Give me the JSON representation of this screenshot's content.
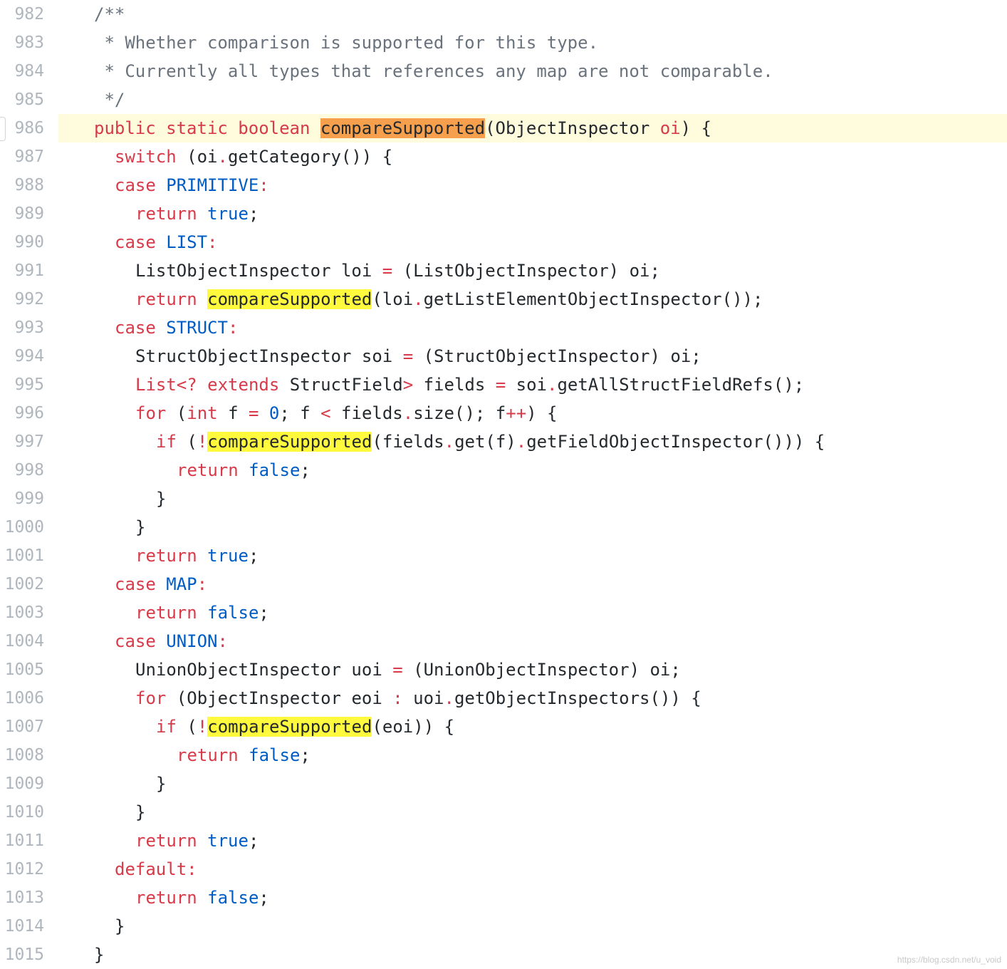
{
  "current_line": 986,
  "search_term": "compareSupported",
  "colors": {
    "keyword": "#d73a49",
    "literal": "#005cc5",
    "comment": "#6a737d",
    "plain": "#24292e",
    "line_number": "#b0b6bd",
    "current_line_bg": "#fffbdd",
    "current_match_bg": "#f6a04d",
    "match_bg": "#fffa3d"
  },
  "lines": [
    {
      "n": "982",
      "indent": 0,
      "tokens": [
        {
          "t": "/**",
          "c": "cm"
        }
      ]
    },
    {
      "n": "983",
      "indent": 0,
      "tokens": [
        {
          "t": " * Whether comparison is supported for this type.",
          "c": "cm"
        }
      ]
    },
    {
      "n": "984",
      "indent": 0,
      "tokens": [
        {
          "t": " * Currently all types that references any map are not comparable.",
          "c": "cm"
        }
      ]
    },
    {
      "n": "985",
      "indent": 0,
      "tokens": [
        {
          "t": " */",
          "c": "cm"
        }
      ]
    },
    {
      "n": "986",
      "indent": 0,
      "tokens": [
        {
          "t": "public static boolean",
          "c": "kw"
        },
        {
          "t": " "
        },
        {
          "t": "compareSupported",
          "hl": "current"
        },
        {
          "t": "(ObjectInspector "
        },
        {
          "t": "oi",
          "c": "kw"
        },
        {
          "t": ") {"
        }
      ]
    },
    {
      "n": "987",
      "indent": 1,
      "tokens": [
        {
          "t": "switch",
          "c": "kw"
        },
        {
          "t": " (oi"
        },
        {
          "t": ".",
          "c": "op"
        },
        {
          "t": "getCategory()) {"
        }
      ]
    },
    {
      "n": "988",
      "indent": 1,
      "tokens": [
        {
          "t": "case",
          "c": "kw"
        },
        {
          "t": " "
        },
        {
          "t": "PRIMITIVE",
          "c": "lit"
        },
        {
          "t": ":",
          "c": "op"
        }
      ]
    },
    {
      "n": "989",
      "indent": 2,
      "tokens": [
        {
          "t": "return",
          "c": "kw"
        },
        {
          "t": " "
        },
        {
          "t": "true",
          "c": "lit"
        },
        {
          "t": ";"
        }
      ]
    },
    {
      "n": "990",
      "indent": 1,
      "tokens": [
        {
          "t": "case",
          "c": "kw"
        },
        {
          "t": " "
        },
        {
          "t": "LIST",
          "c": "lit"
        },
        {
          "t": ":",
          "c": "op"
        }
      ]
    },
    {
      "n": "991",
      "indent": 2,
      "tokens": [
        {
          "t": "ListObjectInspector loi "
        },
        {
          "t": "=",
          "c": "op"
        },
        {
          "t": " (ListObjectInspector) oi;"
        }
      ]
    },
    {
      "n": "992",
      "indent": 2,
      "tokens": [
        {
          "t": "return",
          "c": "kw"
        },
        {
          "t": " "
        },
        {
          "t": "compareSupported",
          "hl": "match"
        },
        {
          "t": "(loi"
        },
        {
          "t": ".",
          "c": "op"
        },
        {
          "t": "getListElementObjectInspector());"
        }
      ]
    },
    {
      "n": "993",
      "indent": 1,
      "tokens": [
        {
          "t": "case",
          "c": "kw"
        },
        {
          "t": " "
        },
        {
          "t": "STRUCT",
          "c": "lit"
        },
        {
          "t": ":",
          "c": "op"
        }
      ]
    },
    {
      "n": "994",
      "indent": 2,
      "tokens": [
        {
          "t": "StructObjectInspector soi "
        },
        {
          "t": "=",
          "c": "op"
        },
        {
          "t": " (StructObjectInspector) oi;"
        }
      ]
    },
    {
      "n": "995",
      "indent": 2,
      "tokens": [
        {
          "t": "List<? extends",
          "c": "kw"
        },
        {
          "t": " StructField"
        },
        {
          "t": ">",
          "c": "op"
        },
        {
          "t": " fields "
        },
        {
          "t": "=",
          "c": "op"
        },
        {
          "t": " soi"
        },
        {
          "t": ".",
          "c": "op"
        },
        {
          "t": "getAllStructFieldRefs();"
        }
      ]
    },
    {
      "n": "996",
      "indent": 2,
      "tokens": [
        {
          "t": "for",
          "c": "kw"
        },
        {
          "t": " ("
        },
        {
          "t": "int",
          "c": "kw"
        },
        {
          "t": " f "
        },
        {
          "t": "=",
          "c": "op"
        },
        {
          "t": " "
        },
        {
          "t": "0",
          "c": "lit"
        },
        {
          "t": "; f "
        },
        {
          "t": "<",
          "c": "op"
        },
        {
          "t": " fields"
        },
        {
          "t": ".",
          "c": "op"
        },
        {
          "t": "size(); f"
        },
        {
          "t": "++",
          "c": "op"
        },
        {
          "t": ") {"
        }
      ]
    },
    {
      "n": "997",
      "indent": 3,
      "tokens": [
        {
          "t": "if",
          "c": "kw"
        },
        {
          "t": " ("
        },
        {
          "t": "!",
          "c": "op"
        },
        {
          "t": "compareSupported",
          "hl": "match"
        },
        {
          "t": "(fields"
        },
        {
          "t": ".",
          "c": "op"
        },
        {
          "t": "get(f)"
        },
        {
          "t": ".",
          "c": "op"
        },
        {
          "t": "getFieldObjectInspector())) {"
        }
      ]
    },
    {
      "n": "998",
      "indent": 4,
      "tokens": [
        {
          "t": "return",
          "c": "kw"
        },
        {
          "t": " "
        },
        {
          "t": "false",
          "c": "lit"
        },
        {
          "t": ";"
        }
      ]
    },
    {
      "n": "999",
      "indent": 3,
      "tokens": [
        {
          "t": "}"
        }
      ]
    },
    {
      "n": "1000",
      "indent": 2,
      "tokens": [
        {
          "t": "}"
        }
      ]
    },
    {
      "n": "1001",
      "indent": 2,
      "tokens": [
        {
          "t": "return",
          "c": "kw"
        },
        {
          "t": " "
        },
        {
          "t": "true",
          "c": "lit"
        },
        {
          "t": ";"
        }
      ]
    },
    {
      "n": "1002",
      "indent": 1,
      "tokens": [
        {
          "t": "case",
          "c": "kw"
        },
        {
          "t": " "
        },
        {
          "t": "MAP",
          "c": "lit"
        },
        {
          "t": ":",
          "c": "op"
        }
      ]
    },
    {
      "n": "1003",
      "indent": 2,
      "tokens": [
        {
          "t": "return",
          "c": "kw"
        },
        {
          "t": " "
        },
        {
          "t": "false",
          "c": "lit"
        },
        {
          "t": ";"
        }
      ]
    },
    {
      "n": "1004",
      "indent": 1,
      "tokens": [
        {
          "t": "case",
          "c": "kw"
        },
        {
          "t": " "
        },
        {
          "t": "UNION",
          "c": "lit"
        },
        {
          "t": ":",
          "c": "op"
        }
      ]
    },
    {
      "n": "1005",
      "indent": 2,
      "tokens": [
        {
          "t": "UnionObjectInspector uoi "
        },
        {
          "t": "=",
          "c": "op"
        },
        {
          "t": " (UnionObjectInspector) oi;"
        }
      ]
    },
    {
      "n": "1006",
      "indent": 2,
      "tokens": [
        {
          "t": "for",
          "c": "kw"
        },
        {
          "t": " (ObjectInspector eoi "
        },
        {
          "t": ":",
          "c": "op"
        },
        {
          "t": " uoi"
        },
        {
          "t": ".",
          "c": "op"
        },
        {
          "t": "getObjectInspectors()) {"
        }
      ]
    },
    {
      "n": "1007",
      "indent": 3,
      "tokens": [
        {
          "t": "if",
          "c": "kw"
        },
        {
          "t": " ("
        },
        {
          "t": "!",
          "c": "op"
        },
        {
          "t": "compareSupported",
          "hl": "match"
        },
        {
          "t": "(eoi)) {"
        }
      ]
    },
    {
      "n": "1008",
      "indent": 4,
      "tokens": [
        {
          "t": "return",
          "c": "kw"
        },
        {
          "t": " "
        },
        {
          "t": "false",
          "c": "lit"
        },
        {
          "t": ";"
        }
      ]
    },
    {
      "n": "1009",
      "indent": 3,
      "tokens": [
        {
          "t": "}"
        }
      ]
    },
    {
      "n": "1010",
      "indent": 2,
      "tokens": [
        {
          "t": "}"
        }
      ]
    },
    {
      "n": "1011",
      "indent": 2,
      "tokens": [
        {
          "t": "return",
          "c": "kw"
        },
        {
          "t": " "
        },
        {
          "t": "true",
          "c": "lit"
        },
        {
          "t": ";"
        }
      ]
    },
    {
      "n": "1012",
      "indent": 1,
      "tokens": [
        {
          "t": "default",
          "c": "kw"
        },
        {
          "t": ":",
          "c": "op"
        }
      ]
    },
    {
      "n": "1013",
      "indent": 2,
      "tokens": [
        {
          "t": "return",
          "c": "kw"
        },
        {
          "t": " "
        },
        {
          "t": "false",
          "c": "lit"
        },
        {
          "t": ";"
        }
      ]
    },
    {
      "n": "1014",
      "indent": 1,
      "tokens": [
        {
          "t": "}"
        }
      ]
    },
    {
      "n": "1015",
      "indent": 0,
      "tokens": [
        {
          "t": "}"
        }
      ]
    }
  ],
  "watermark": "https://blog.csdn.net/u_void"
}
